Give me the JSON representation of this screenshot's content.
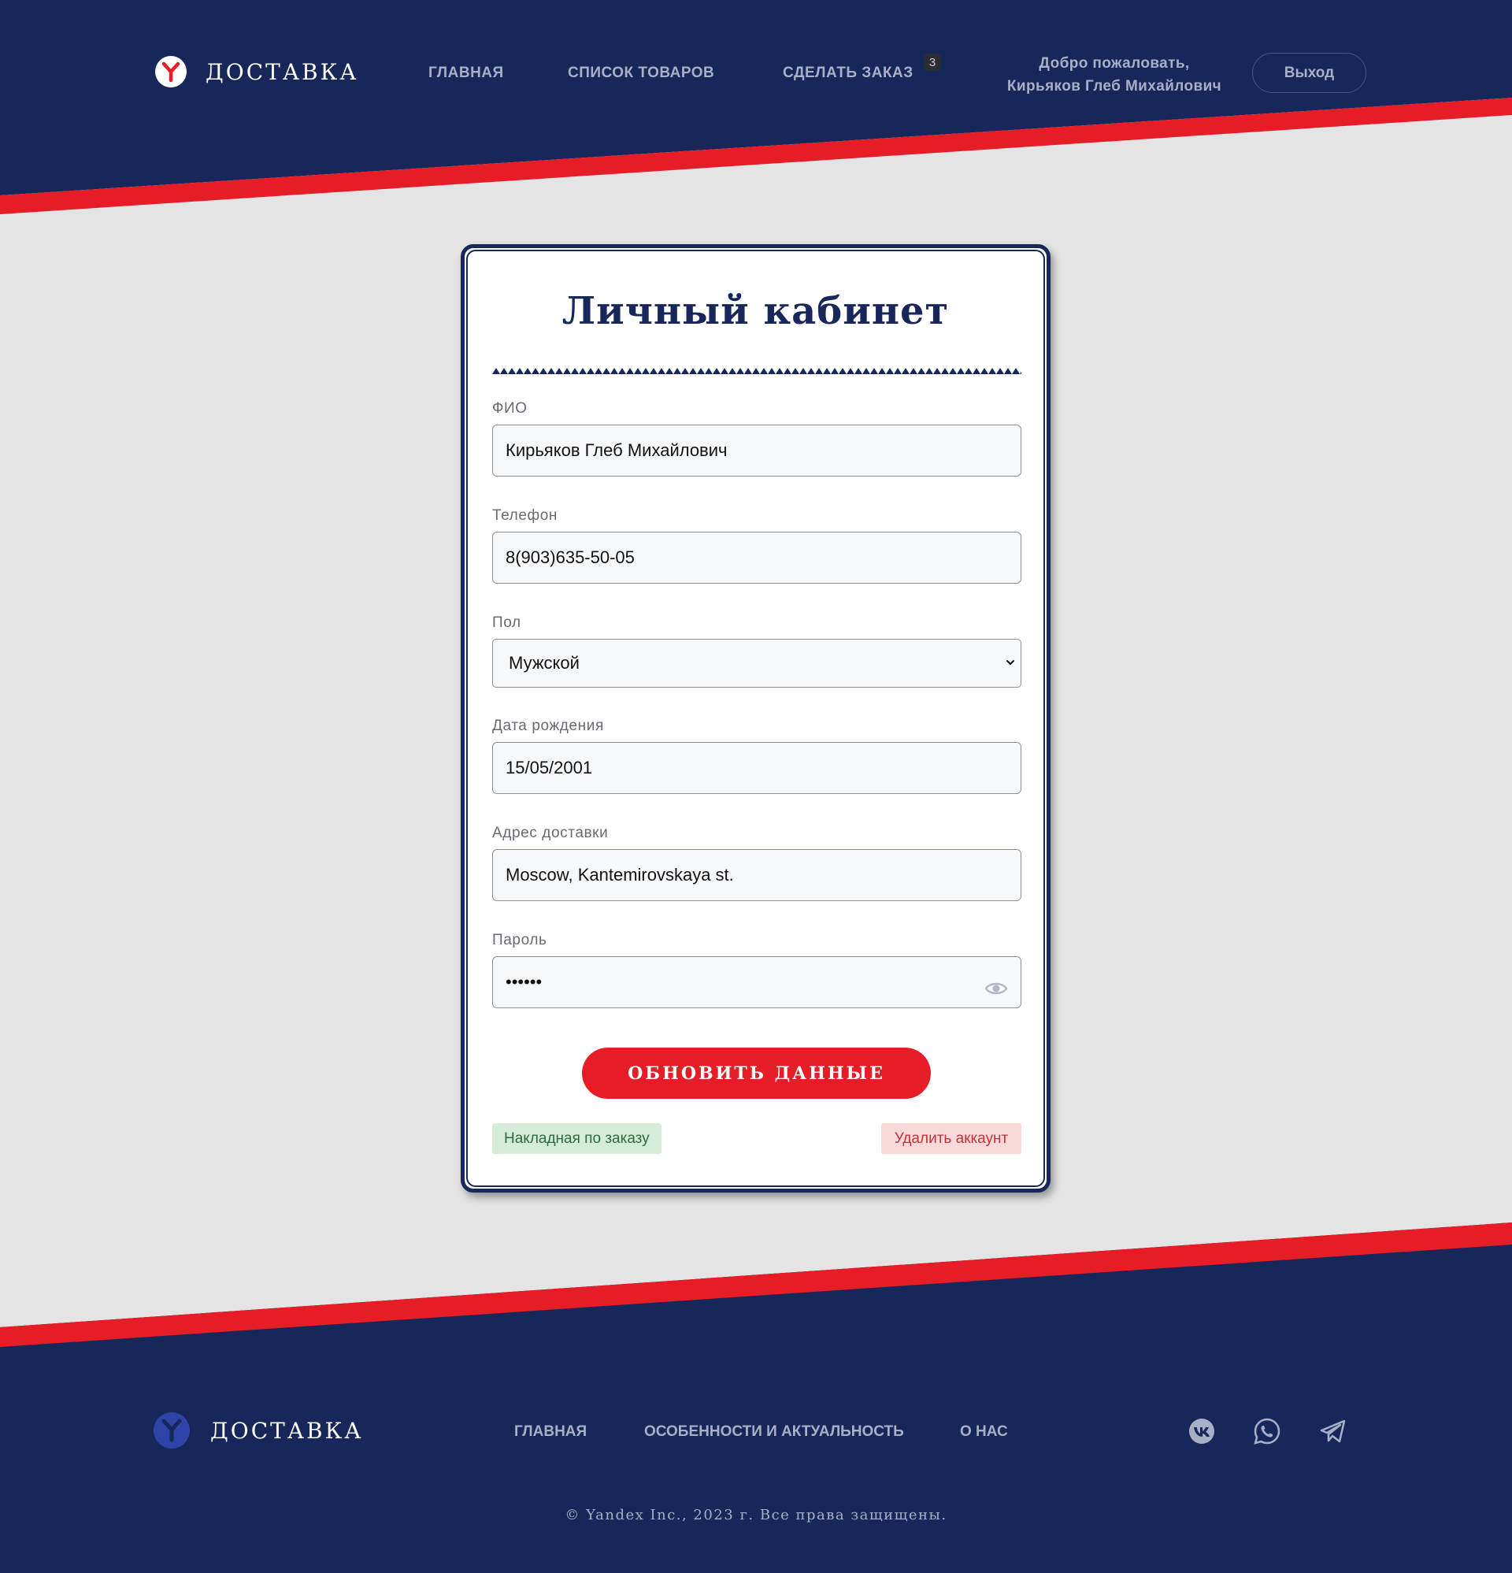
{
  "brand": {
    "name": "ДОСТАВКА"
  },
  "header": {
    "nav": [
      "ГЛАВНАЯ",
      "СПИСОК ТОВАРОВ",
      "СДЕЛАТЬ ЗАКАЗ"
    ],
    "cart_count": "3",
    "welcome_line1": "Добро пожаловать,",
    "welcome_line2": "Кирьяков Глеб Михайлович",
    "logout_label": "Выход"
  },
  "form": {
    "title": "Личный кабинет",
    "fields": [
      {
        "label": "ФИО",
        "value": "Кирьяков Глеб Михайлович"
      },
      {
        "label": "Телефон",
        "value": "8(903)635-50-05"
      },
      {
        "label": "Пол",
        "value": "Мужской"
      },
      {
        "label": "Дата рождения",
        "value": "15/05/2001"
      },
      {
        "label": "Адрес доставки",
        "value": "Moscow, Kantemirovskaya st."
      },
      {
        "label": "Пароль",
        "value": "••••••"
      }
    ],
    "update_label": "ОБНОВИТЬ ДАННЫЕ",
    "invoice_label": "Накладная по заказу",
    "delete_label": "Удалить аккаунт"
  },
  "footer": {
    "nav": [
      "ГЛАВНАЯ",
      "ОСОБЕННОСТИ И АКТУАЛЬНОСТЬ",
      "О НАС"
    ],
    "social": [
      "vk-icon",
      "whatsapp-icon",
      "telegram-icon"
    ],
    "copyright": "© Yandex Inc., 2023 г. Все права защищены."
  },
  "colors": {
    "navy": "#17275a",
    "red": "#e61d27",
    "background": "#e4e4e4",
    "muted_text": "#a7b0c6"
  }
}
